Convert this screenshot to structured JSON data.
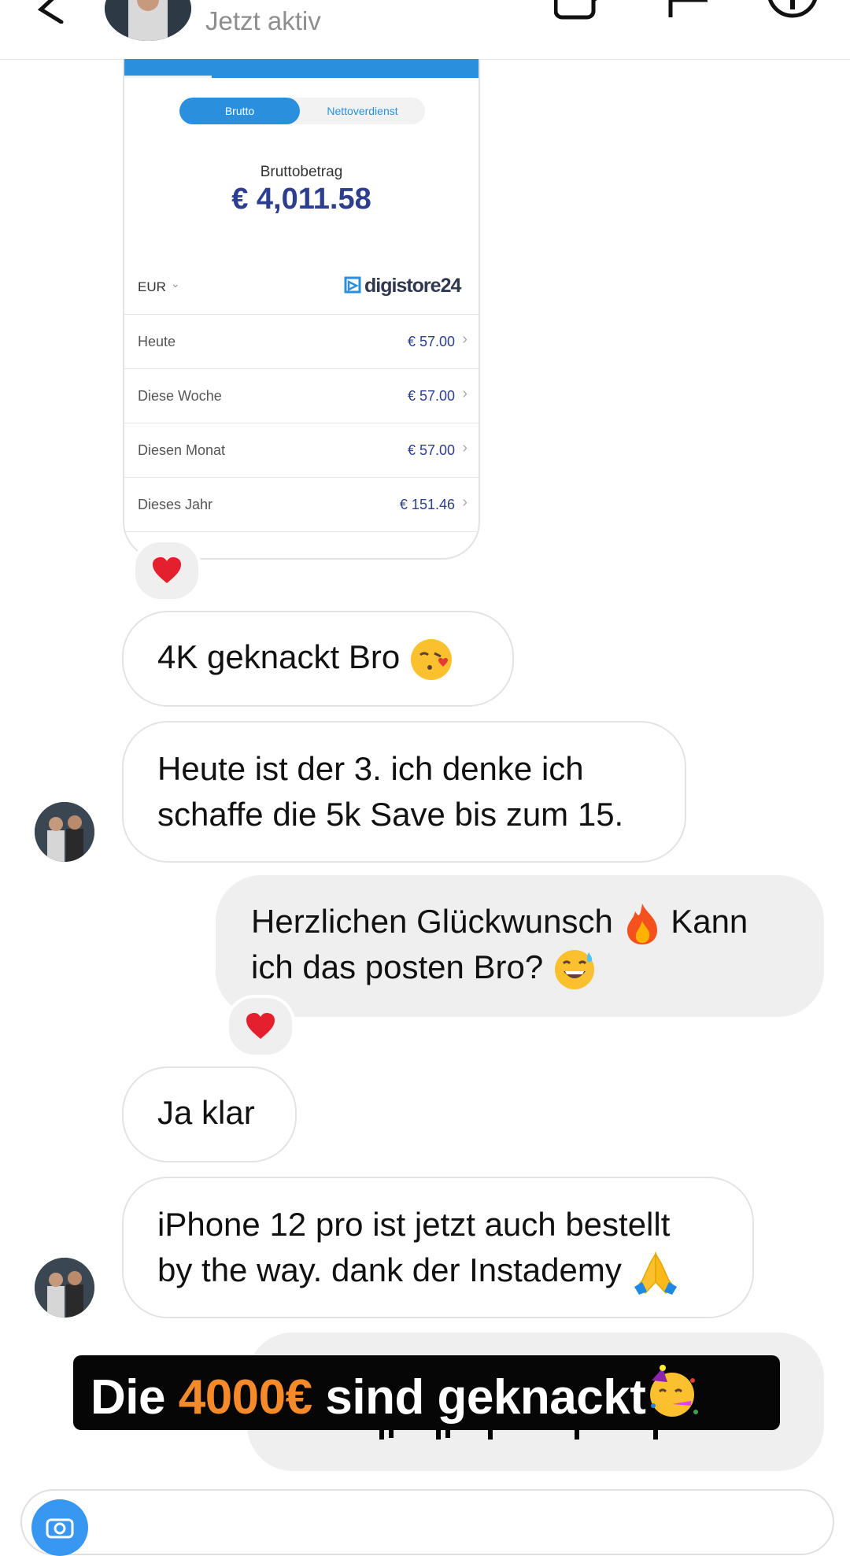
{
  "header": {
    "status": "Jetzt aktiv",
    "back_icon": "chevron-left-icon",
    "video_icon": "video-call-icon",
    "flag_icon": "flag-icon",
    "info_icon": "info-icon"
  },
  "shared_screenshot": {
    "toggle_active": "Brutto",
    "toggle_inactive": "Nettoverdienst",
    "amount_label": "Bruttobetrag",
    "amount": "€ 4,011.58",
    "currency": "EUR",
    "brand": "digistore24",
    "accent_color": "#2a8fdd",
    "amount_color": "#2d3e8f",
    "rows": [
      {
        "label": "Heute",
        "value": "€ 57.00"
      },
      {
        "label": "Diese Woche",
        "value": "€ 57.00"
      },
      {
        "label": "Diesen Monat",
        "value": "€ 57.00"
      },
      {
        "label": "Dieses Jahr",
        "value": "€ 151.46"
      }
    ]
  },
  "messages": [
    {
      "side": "in",
      "text": "4K geknackt Bro",
      "emoji": "kissing-heart-emoji"
    },
    {
      "side": "in",
      "lines": [
        "Heute ist der 3. ich denke ich",
        "schaffe die 5k Save bis zum 15."
      ]
    },
    {
      "side": "out",
      "lines": [
        "Herzlichen Glückwunsch",
        "Kann",
        "ich das posten Bro?"
      ],
      "emoji": [
        "fire-emoji",
        "sweat-smile-emoji"
      ]
    },
    {
      "side": "in",
      "text": "Ja klar"
    },
    {
      "side": "in",
      "lines": [
        "iPhone 12 pro ist jetzt auch bestellt",
        "by the way. dank der Instademy"
      ],
      "emoji": "folded-hands-emoji"
    }
  ],
  "reactions": {
    "emoji": "red-heart-emoji"
  },
  "caption": {
    "part1": "Die ",
    "highlight": "4000€",
    "part2": " sind geknackt",
    "emoji": "partying-face-emoji",
    "highlight_color": "#f58a2b"
  },
  "composer": {
    "camera_icon": "camera-icon"
  }
}
